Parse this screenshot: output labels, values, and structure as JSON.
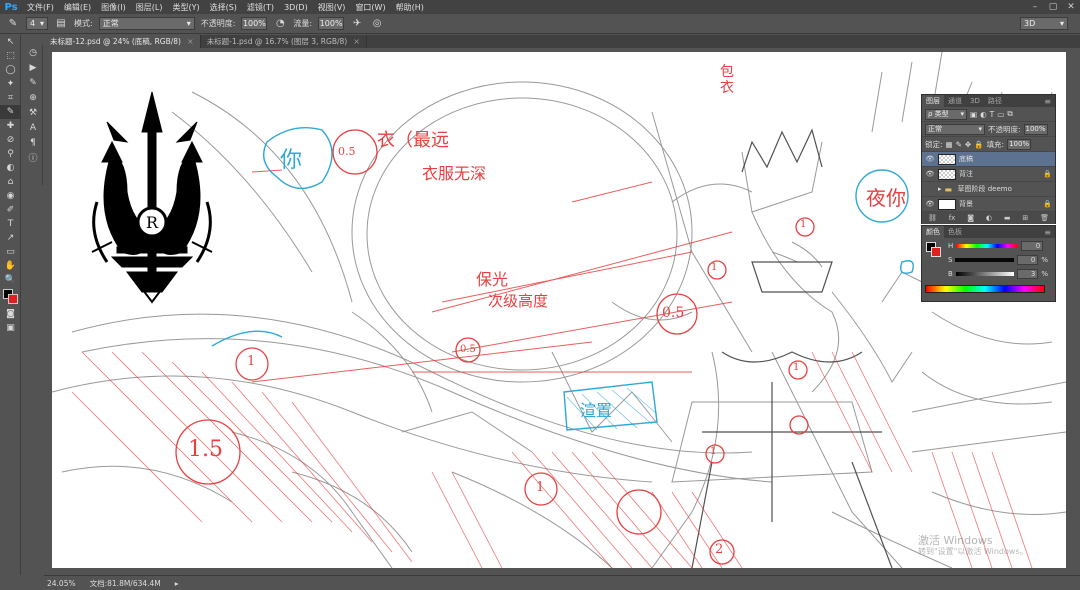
{
  "app": {
    "logo": "Ps",
    "menu": [
      "文件(F)",
      "编辑(E)",
      "图像(I)",
      "图层(L)",
      "类型(Y)",
      "选择(S)",
      "滤镜(T)",
      "3D(D)",
      "视图(V)",
      "窗口(W)",
      "帮助(H)"
    ],
    "window_controls": [
      "–",
      "▢",
      "✕"
    ]
  },
  "options": {
    "brush_size": "4",
    "mode_label": "模式:",
    "mode_value": "正常",
    "opacity_label": "不透明度:",
    "opacity_value": "100%",
    "flow_label": "流量:",
    "flow_value": "100%",
    "workspace": "3D"
  },
  "tabs": [
    {
      "label": "未标题-12.psd @ 24% (底稿, RGB/8)",
      "close": "×"
    },
    {
      "label": "未标题-1.psd @ 16.7% (图层 3, RGB/8)",
      "close": "×"
    }
  ],
  "tools": [
    "↖",
    "⬚",
    "◯",
    "✦",
    "⌗",
    "✎",
    "✚",
    "⊘",
    "⚲",
    "◐",
    "⌂",
    "◉",
    "✐",
    "T",
    "↗",
    "▭",
    "✋",
    "🔍"
  ],
  "status": {
    "zoom": "24.05%",
    "doc_info": "文档:81.8M/634.4M"
  },
  "canvas_annotations": {
    "c05": "0.5",
    "l1": "衣（最远",
    "l2": "衣服无深",
    "baoyi": "包衣",
    "jiaolan": "你",
    "huan": "夜你",
    "wufu": "保光",
    "wufu2": "次级高度",
    "c1": "1",
    "c15": "1.5",
    "c05b": "0.5",
    "c05c": "0.5",
    "sanjiao": "渲置",
    "c1b": "1",
    "c1c": "1",
    "c2": "2",
    "c1d": "1",
    "c1e": "1",
    "c1f": "1"
  },
  "layers_panel": {
    "tabs": [
      "图层",
      "通道",
      "3D",
      "路径"
    ],
    "kind_filter": "ρ 类型",
    "blend_mode": "正常",
    "opacity_label": "不透明度:",
    "opacity_value": "100%",
    "lock_label": "锁定:",
    "fill_label": "填充:",
    "fill_value": "100%",
    "layers": [
      {
        "name": "底稿",
        "selected": true
      },
      {
        "name": "背注",
        "selected": false
      },
      {
        "name": "草图阶段 deemo",
        "selected": false
      },
      {
        "name": "背景",
        "selected": false
      }
    ]
  },
  "color_panel": {
    "tabs": [
      "颜色",
      "色板"
    ],
    "sliders": [
      {
        "label": "H",
        "value": "0",
        "unit": ""
      },
      {
        "label": "S",
        "value": "0",
        "unit": "%"
      },
      {
        "label": "B",
        "value": "3",
        "unit": "%"
      }
    ]
  },
  "watermark": {
    "line1": "激活 Windows",
    "line2": "转到\"设置\"以激活 Windows。"
  }
}
